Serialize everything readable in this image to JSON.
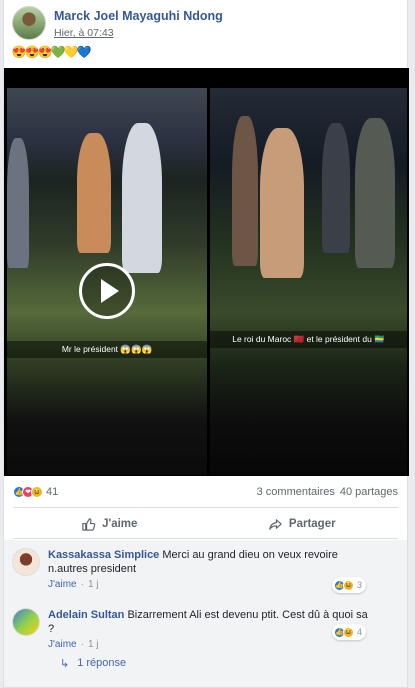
{
  "post": {
    "author": "Marck Joel Mayaguhi Ndong",
    "time": "Hier, à 07:43",
    "emoji_text": [
      "😍",
      "😍",
      "😍",
      "💚",
      "💛",
      "💙"
    ]
  },
  "media": {
    "left_caption": "Mr le président 😱😱😱",
    "right_caption": "Le roi du Maroc 🇲🇦 et le président du 🇬🇦"
  },
  "stats": {
    "reaction_count": "41",
    "comments": "3 commentaires",
    "shares": "40 partages"
  },
  "actions": {
    "like": "J'aime",
    "share": "Partager"
  },
  "comments": [
    {
      "name": "Kassakassa Simplice",
      "text": "Merci au grand dieu on veux revoire n.autres president",
      "like": "J'aime",
      "time": "1 j",
      "reactions": "3"
    },
    {
      "name": "Adelain Sultan",
      "text": "Bizarrement Ali est devenu ptit. Cest dû à quoi sa ?",
      "like": "J'aime",
      "time": "1 j",
      "reactions": "4"
    }
  ],
  "replies": {
    "arrow": "↳",
    "label": "1 réponse"
  },
  "colors": {
    "link_blue": "#365899",
    "action_blue": "#4267b2",
    "like_blue": "#1877f2",
    "love_red": "#f33e58",
    "haha_yellow": "#f7b125"
  }
}
